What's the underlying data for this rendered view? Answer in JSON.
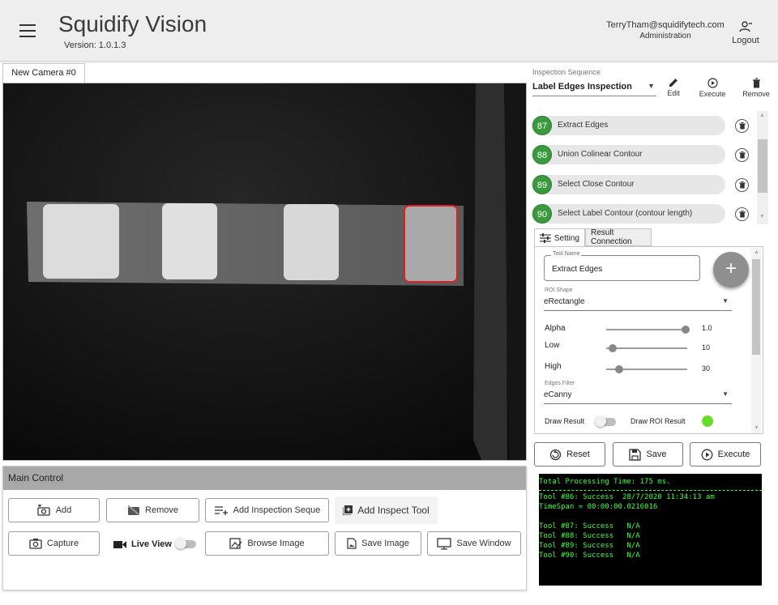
{
  "header": {
    "title": "Squidify Vision",
    "version": "Version: 1.0.1.3",
    "user_email": "TerryTham@squidifytech.com",
    "user_role": "Administration",
    "logout_label": "Logout"
  },
  "camera": {
    "tab_label": "New Camera #0"
  },
  "main_control": {
    "title": "Main Control",
    "buttons": {
      "add": "Add",
      "remove": "Remove",
      "add_inspection_sequence": "Add Inspection Seque",
      "add_inspect_tool": "Add Inspect Tool",
      "capture": "Capture",
      "live_view": "Live View",
      "browse_image": "Browse Image",
      "save_image": "Save Image",
      "save_window": "Save Window"
    }
  },
  "inspection": {
    "section_label": "Inspection Sequence",
    "selected_sequence": "Label Edges Inspection",
    "toolbar": {
      "edit": "Edit",
      "execute": "Execute",
      "remove": "Remove"
    },
    "tools": [
      {
        "num": "87",
        "name": "Extract Edges"
      },
      {
        "num": "88",
        "name": "Union Colinear Contour"
      },
      {
        "num": "89",
        "name": "Select Close Contour"
      },
      {
        "num": "90",
        "name": "Select Label Contour (contour length)"
      }
    ]
  },
  "settings": {
    "tab_setting": "Setting",
    "tab_result_connection": "Result Connection",
    "tool_name_label": "Tool Name",
    "tool_name_value": "Extract Edges",
    "roi_shape_label": "ROI Shape",
    "roi_shape_value": "eRectangle",
    "alpha_label": "Alpha",
    "alpha_value": "1.0",
    "alpha_fraction": 0.98,
    "low_label": "Low",
    "low_value": "10",
    "low_fraction": 0.08,
    "high_label": "High",
    "high_value": "30",
    "high_fraction": 0.16,
    "edges_filter_label": "Edges Filter",
    "edges_filter_value": "eCanny",
    "draw_result_label": "Draw Result",
    "draw_roi_result_label": "Draw ROI Result",
    "roi_status_color": "#66dd2a"
  },
  "actions": {
    "reset": "Reset",
    "save": "Save",
    "execute": "Execute"
  },
  "console": {
    "lines_top": [
      "Total Processing Time: 175 ms."
    ],
    "lines_bottom": [
      "Tool #86: Success  28/7/2020 11:34:13 am",
      "TimeSpan = 00:00:00.0216016",
      "",
      "Tool #87: Success   N/A",
      "Tool #88: Success   N/A",
      "Tool #89: Success   N/A",
      "Tool #90: Success   N/A"
    ]
  },
  "colors": {
    "accent_green": "#3a9a3e",
    "console_text": "#3fff3f",
    "roi_highlight": "#e02020"
  }
}
